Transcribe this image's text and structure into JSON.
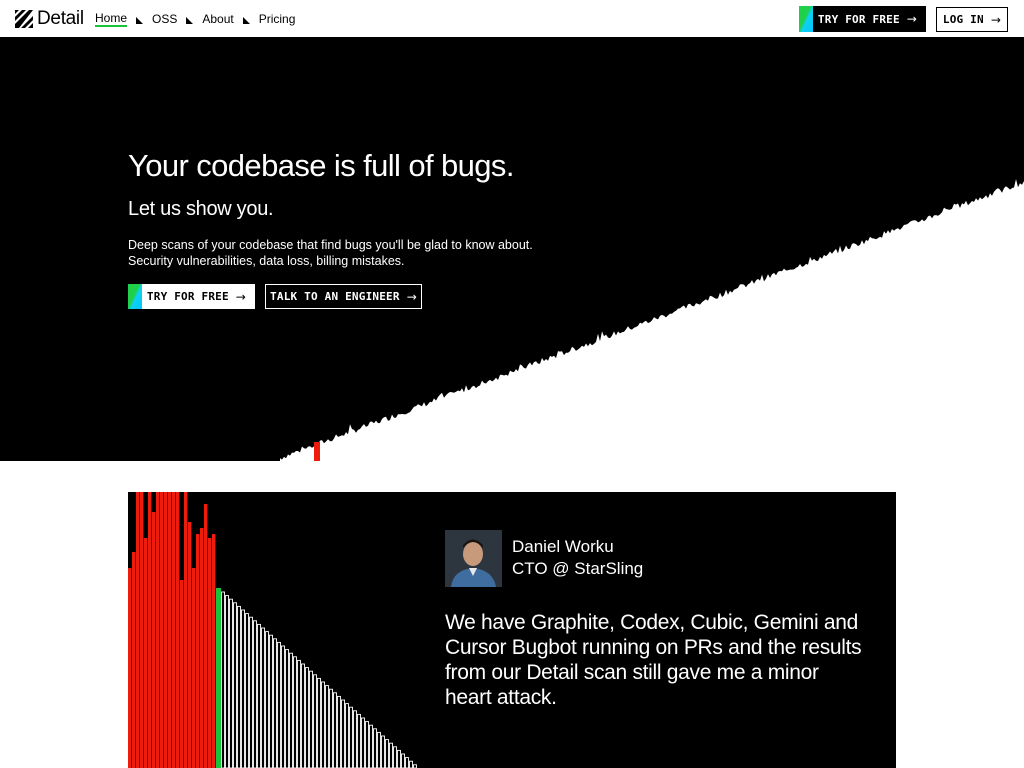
{
  "brand": {
    "name": "Detail",
    "logo_icon": "diagonal-stripes-icon"
  },
  "nav": {
    "links": [
      {
        "label": "Home",
        "active": true
      },
      {
        "label": "OSS",
        "active": false
      },
      {
        "label": "About",
        "active": false
      },
      {
        "label": "Pricing",
        "active": false
      }
    ],
    "try_free_label": "TRY FOR FREE",
    "login_label": "LOG IN"
  },
  "hero": {
    "title": "Your codebase is full of bugs.",
    "subtitle": "Let us show you.",
    "description_line1": "Deep scans of your codebase that find bugs you'll be glad to know about.",
    "description_line2": "Security vulnerabilities, data loss, billing mistakes.",
    "cta_primary": "TRY FOR FREE",
    "cta_secondary": "TALK TO AN ENGINEER"
  },
  "testimonial": {
    "name": "Daniel Worku",
    "role": "CTO @ StarSling",
    "quote": "We have Graphite, Codex, Cubic, Gemini and Cursor Bugbot running on PRs and the results from our Detail scan still gave me a minor heart attack."
  },
  "colors": {
    "accent_green": "#19c43a",
    "accent_cyan": "#0fd0f0",
    "bug_red": "#ee1c0c",
    "background_dark": "#000000"
  }
}
